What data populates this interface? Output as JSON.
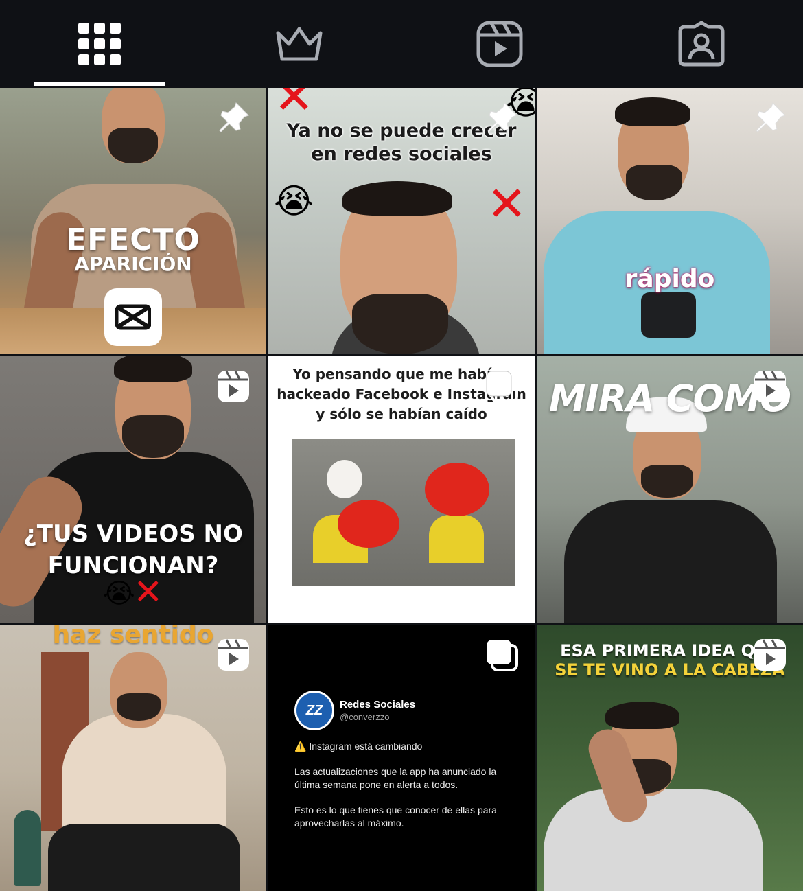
{
  "tabs": [
    {
      "name": "posts",
      "icon": "grid-icon",
      "selected": true
    },
    {
      "name": "subscriptions",
      "icon": "crown-icon",
      "selected": false
    },
    {
      "name": "reels",
      "icon": "reels-icon",
      "selected": false
    },
    {
      "name": "tagged",
      "icon": "tagged-user-icon",
      "selected": false
    }
  ],
  "colors": {
    "background": "#0f1115",
    "icon": "#ffffff",
    "icon_inactive": "#a8acb3"
  },
  "posts": [
    {
      "badge": "pin-icon",
      "lines": [
        "EFECTO",
        "APARICIÓN"
      ]
    },
    {
      "badge": "pin-icon",
      "lines": [
        "Ya no se puede crecer",
        "en redes sociales"
      ]
    },
    {
      "badge": "pin-icon",
      "lines": [
        "rápido"
      ]
    },
    {
      "badge": "reel-icon",
      "lines": [
        "¿TUS VIDEOS NO",
        "FUNCIONAN?"
      ]
    },
    {
      "badge": "carousel-icon",
      "lines": [
        "Yo pensando que me habían",
        "hackeado Facebook e Instagram",
        "y sólo se habían caído"
      ]
    },
    {
      "badge": "reel-icon",
      "lines": [
        "MIRA COMO"
      ]
    },
    {
      "badge": "reel-icon",
      "lines": [
        "haz sentido"
      ]
    },
    {
      "badge": "carousel-icon",
      "tweet": {
        "avatar_text": "ZZ",
        "name": "Redes Sociales",
        "handle": "@converzzo",
        "p1": "⚠️ Instagram está cambiando",
        "p2": "Las actualizaciones que la app ha anunciado la última semana pone en alerta a todos.",
        "p3": "Esto es lo que tienes que conocer de ellas para aprovecharlas al máximo."
      }
    },
    {
      "badge": "reel-icon",
      "lines": [
        "ESA PRIMERA IDEA QUE",
        "SE TE VINO A LA CABEZA"
      ]
    }
  ]
}
